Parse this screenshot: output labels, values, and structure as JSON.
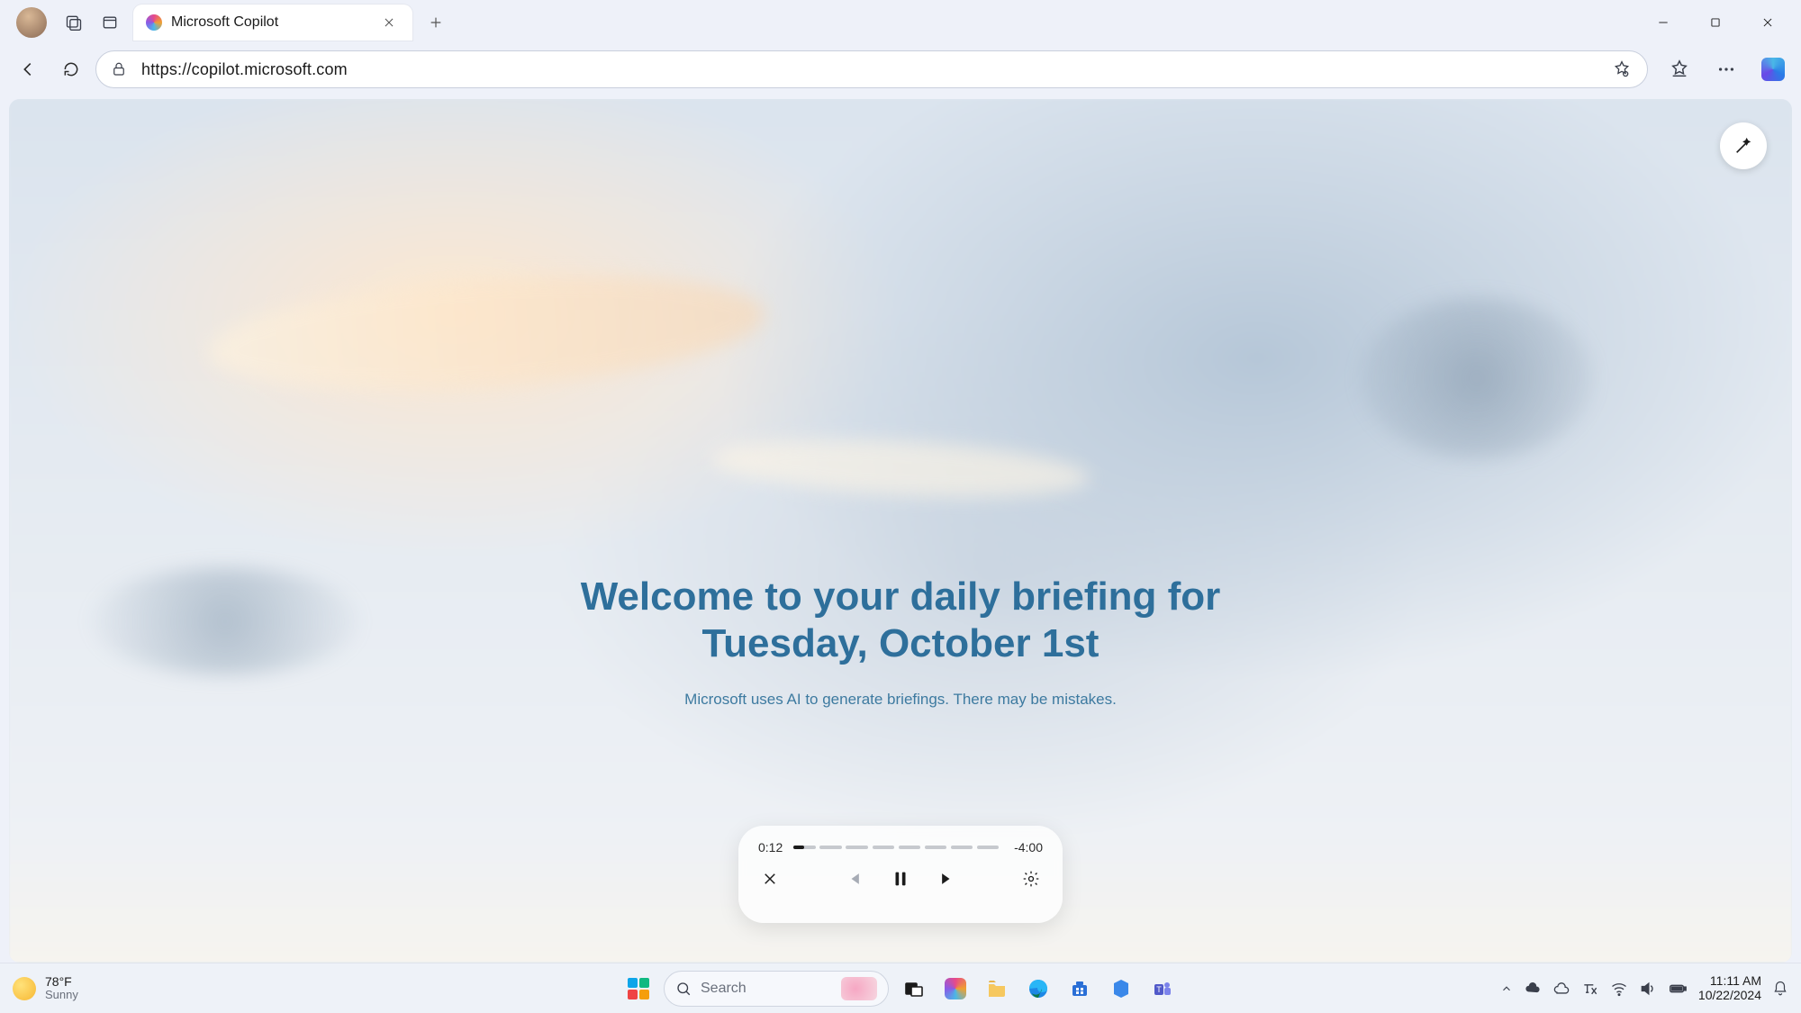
{
  "titlebar": {
    "tab_title": "Microsoft Copilot"
  },
  "toolbar": {
    "url": "https://copilot.microsoft.com"
  },
  "content": {
    "headline_line1": "Welcome to your daily briefing for",
    "headline_line2": "Tuesday, October 1st",
    "disclaimer": "Microsoft uses AI to generate briefings. There may be mistakes.",
    "player": {
      "elapsed": "0:12",
      "remaining": "-4:00",
      "progress_fraction": 0.05,
      "segments": 8
    }
  },
  "taskbar": {
    "weather_temp": "78°F",
    "weather_cond": "Sunny",
    "search_placeholder": "Search",
    "time": "11:11 AM",
    "date": "10/22/2024"
  },
  "colors": {
    "headline": "#2e6f9b",
    "start": [
      "#0ea5e9",
      "#10b981",
      "#f59e0b",
      "#ef4444"
    ]
  }
}
